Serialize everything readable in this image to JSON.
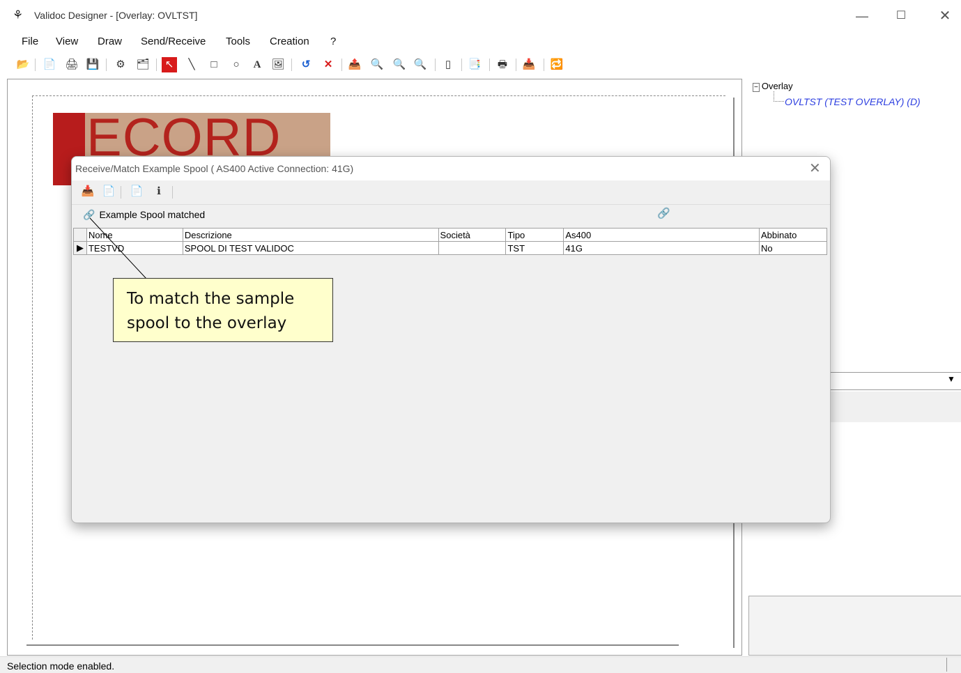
{
  "window": {
    "app_icon": "validoc-app-icon",
    "title": "Validoc Designer - [Overlay: OVLTST]",
    "min": "—",
    "max": "☐",
    "close": "✕"
  },
  "menu": [
    "File",
    "View",
    "Draw",
    "Send/Receive",
    "Tools",
    "Creation",
    "?"
  ],
  "toolbar_icons": [
    "open-icon",
    "new-icon",
    "print-preview-icon",
    "save-icon",
    "select-tool-icon",
    "properties-icon",
    "pointer-icon",
    "line-icon",
    "rectangle-icon",
    "ellipse-icon",
    "text-icon",
    "image-icon",
    "undo-icon",
    "delete-icon",
    "send-icon",
    "zoom-in-icon",
    "zoom-out-icon",
    "zoom-fit-icon",
    "page-icon",
    "export-icon",
    "printer-icon",
    "receive-icon",
    "transfer-icon"
  ],
  "logo": {
    "text": "ECORD"
  },
  "tree": {
    "root": "Overlay",
    "child": "OVLTST (TEST OVERLAY) (D)"
  },
  "status": "Selection mode enabled.",
  "dialog": {
    "title": "Receive/Match Example Spool ( AS400 Active Connection: 41G)",
    "close": "✕",
    "matched_label": "Example Spool matched",
    "columns": [
      "Nome",
      "Descrizione",
      "Società",
      "Tipo",
      "As400",
      "Abbinato"
    ],
    "rows": [
      {
        "nome": "TESTVD",
        "descrizione": "SPOOL DI TEST VALIDOC",
        "societa": "",
        "tipo": "TST",
        "as400": "41G",
        "abbinato": "No"
      }
    ],
    "row_indicator": "▶"
  },
  "callout": {
    "line1": "To match the sample",
    "line2": "spool to the overlay"
  },
  "colors": {
    "accent": "#2d3fe0",
    "logo_red": "#b3231d",
    "callout_bg": "#ffffcc"
  }
}
